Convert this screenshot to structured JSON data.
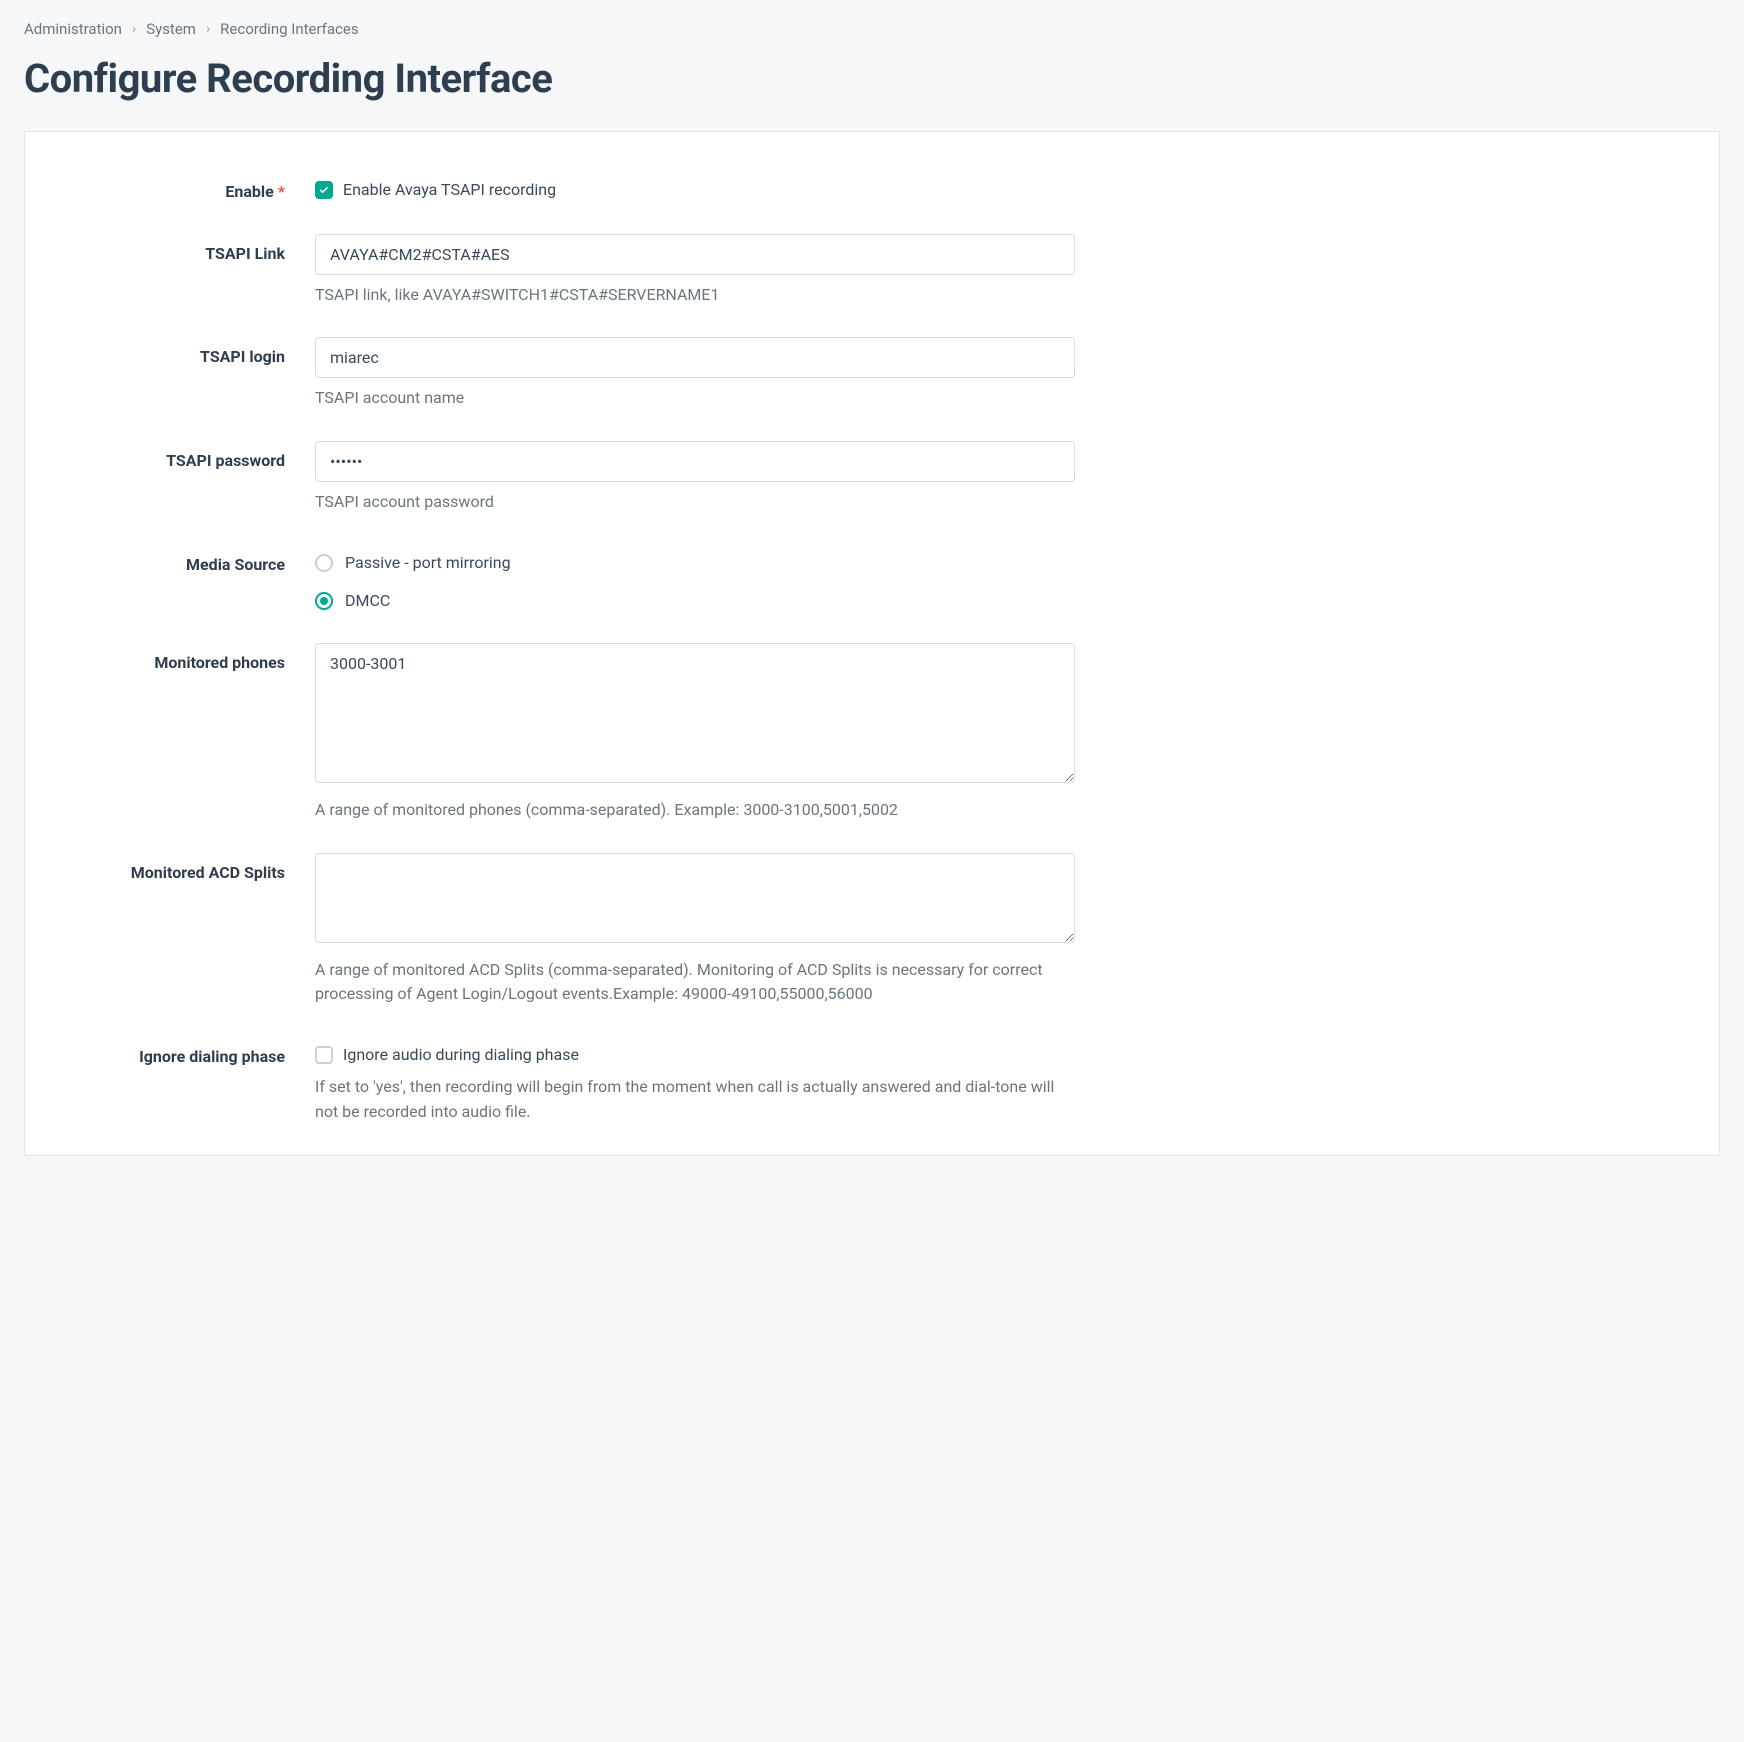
{
  "breadcrumb": {
    "items": [
      "Administration",
      "System",
      "Recording Interfaces"
    ]
  },
  "page_title": "Configure Recording Interface",
  "form": {
    "enable": {
      "label": "Enable",
      "required": "*",
      "checkbox_label": "Enable Avaya TSAPI recording",
      "checked": true
    },
    "tsapi_link": {
      "label": "TSAPI Link",
      "value": "AVAYA#CM2#CSTA#AES",
      "hint": "TSAPI link, like AVAYA#SWITCH1#CSTA#SERVERNAME1"
    },
    "tsapi_login": {
      "label": "TSAPI login",
      "value": "miarec",
      "hint": "TSAPI account name"
    },
    "tsapi_password": {
      "label": "TSAPI password",
      "value": "••••••",
      "hint": "TSAPI account password"
    },
    "media_source": {
      "label": "Media Source",
      "options": [
        {
          "label": "Passive - port mirroring",
          "selected": false
        },
        {
          "label": "DMCC",
          "selected": true
        }
      ]
    },
    "monitored_phones": {
      "label": "Monitored phones",
      "value": "3000-3001",
      "hint": "A range of monitored phones (comma-separated). Example: 3000-3100,5001,5002"
    },
    "monitored_acd": {
      "label": "Monitored ACD Splits",
      "value": "",
      "hint": "A range of monitored ACD Splits (comma-separated). Monitoring of ACD Splits is necessary for correct processing of Agent Login/Logout events.Example: 49000-49100,55000,56000"
    },
    "ignore_dialing": {
      "label": "Ignore dialing phase",
      "checkbox_label": "Ignore audio during dialing phase",
      "checked": false,
      "hint": "If set to 'yes', then recording will begin from the moment when call is actually answered and dial-tone will not be recorded into audio file."
    }
  }
}
